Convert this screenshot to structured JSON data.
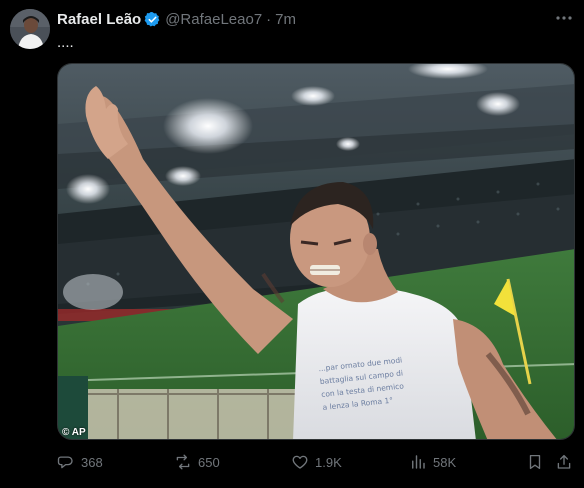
{
  "author": {
    "display_name": "Rafael Leão",
    "handle": "@RafaeLeao7",
    "separator": "·",
    "time": "7m",
    "verified": true
  },
  "tweet": {
    "text": "....",
    "media": {
      "credit": "© AP",
      "shirt_text": [
        "...par ornato due modi",
        "battaglia sul campo di",
        "con la testa di nemico",
        "a lenza la Roma 1°"
      ]
    }
  },
  "actions": {
    "replies": "368",
    "reposts": "650",
    "likes": "1.9K",
    "views": "58K"
  },
  "icons": {
    "more": "more-icon",
    "verified": "verified-badge-icon",
    "reply": "reply-icon",
    "repost": "repost-icon",
    "like": "heart-icon",
    "views": "views-icon",
    "bookmark": "bookmark-icon",
    "share": "share-icon"
  },
  "colors": {
    "background": "#000000",
    "text_primary": "#e7e9ea",
    "text_secondary": "#71767b",
    "verified_blue": "#1d9bf0"
  }
}
